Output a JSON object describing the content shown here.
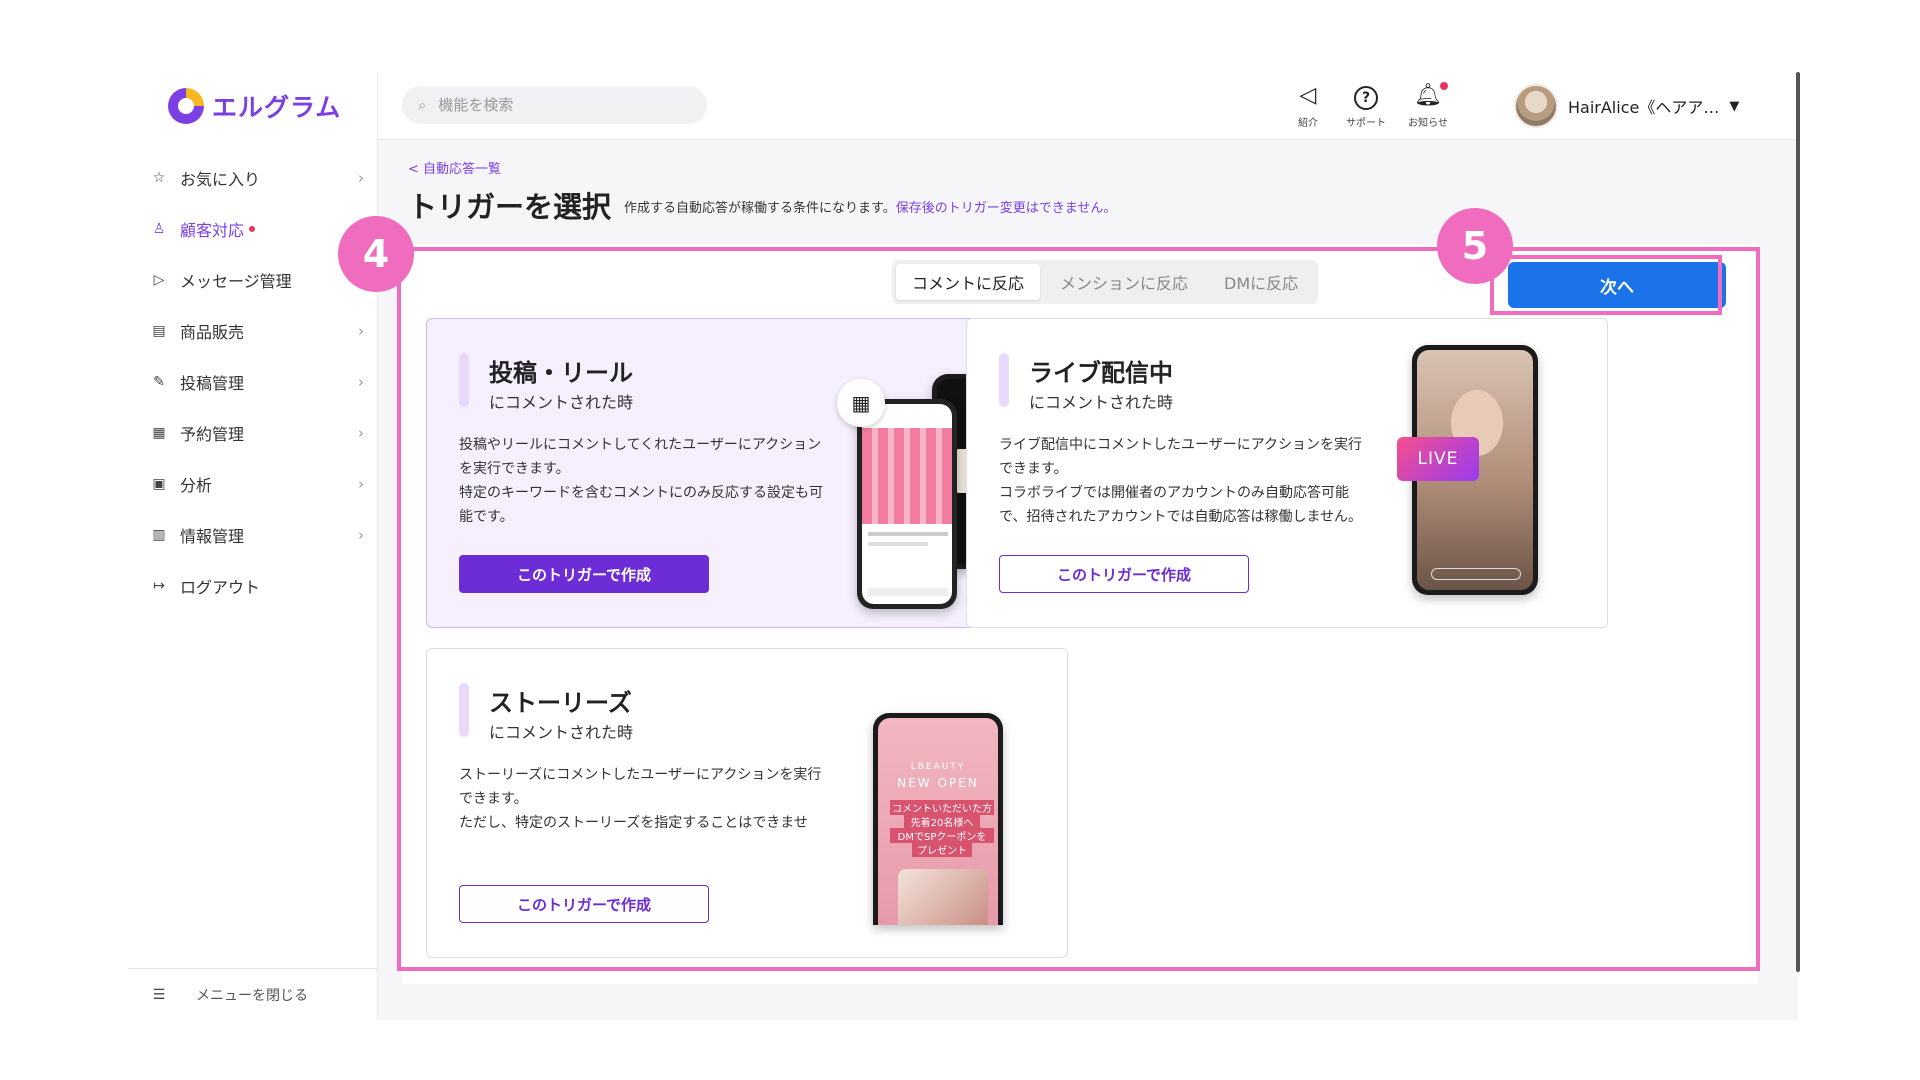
{
  "logo": {
    "text": "エルグラム"
  },
  "sidebar": {
    "items": [
      {
        "icon": "star-icon",
        "glyph": "☆",
        "label": "お気に入り",
        "chevron": true
      },
      {
        "icon": "person-icon",
        "glyph": "♙",
        "label": "顧客対応",
        "chevron": false,
        "active": true,
        "dot": true
      },
      {
        "icon": "send-icon",
        "glyph": "▷",
        "label": "メッセージ管理",
        "chevron": false
      },
      {
        "icon": "store-icon",
        "glyph": "▤",
        "label": "商品販売",
        "chevron": true
      },
      {
        "icon": "edit-icon",
        "glyph": "✎",
        "label": "投稿管理",
        "chevron": true
      },
      {
        "icon": "calendar-icon",
        "glyph": "▦",
        "label": "予約管理",
        "chevron": true
      },
      {
        "icon": "analytics-icon",
        "glyph": "▣",
        "label": "分析",
        "chevron": true
      },
      {
        "icon": "chart-icon",
        "glyph": "▥",
        "label": "情報管理",
        "chevron": true
      },
      {
        "icon": "logout-icon",
        "glyph": "↦",
        "label": "ログアウト",
        "chevron": false
      }
    ],
    "collapse_label": "メニューを閉じる"
  },
  "header": {
    "search_placeholder": "機能を検索",
    "buttons": [
      {
        "icon": "megaphone-icon",
        "glyph": "◁",
        "label": "紹介"
      },
      {
        "icon": "help-icon",
        "glyph": "?",
        "label": "サポート"
      },
      {
        "icon": "bell-icon",
        "glyph": "🔔︎",
        "label": "お知らせ"
      }
    ],
    "user_name": "HairAlice《ヘアア…"
  },
  "page": {
    "breadcrumb": "< 自動応答一覧",
    "title": "トリガーを選択",
    "desc": "作成する自動応答が稼働する条件になります。",
    "desc_warning": "保存後のトリガー変更はできません。"
  },
  "tabs": [
    "コメントに反応",
    "メンションに反応",
    "DMに反応"
  ],
  "next_label": "次へ",
  "cards": [
    {
      "title": "投稿・リール",
      "sub": "にコメントされた時",
      "desc": "投稿やリールにコメントしてくれたユーザーにアクション\nを実行できます。\n特定のキーワードを含むコメントにのみ反応する設定も可\n能です。",
      "button": "このトリガーで作成"
    },
    {
      "title": "ライブ配信中",
      "sub": "にコメントされた時",
      "desc": "ライブ配信中にコメントしたユーザーにアクションを実行\nできます。\nコラボライブでは開催者のアカウントのみ自動応答可能\nで、招待されたアカウントでは自動応答は稼働しません。",
      "button": "このトリガーで作成",
      "live": "LIVE"
    },
    {
      "title": "ストーリーズ",
      "sub": "にコメントされた時",
      "desc": "ストーリーズにコメントしたユーザーにアクションを実行\nできます。\nただし、特定のストーリーズを指定することはできませ",
      "button": "このトリガーで作成",
      "story": {
        "brand": "LBEAUTY",
        "headline": "NEW OPEN",
        "line1": "コメントいただいた方",
        "line2": "先着20名様へ",
        "line3": "DMでSPクーポンを",
        "line4": "プレゼント"
      }
    }
  ],
  "annotations": {
    "step4": "4",
    "step5": "5"
  },
  "colors": {
    "accent": "#7b3fe4",
    "primary_button": "#1a73e8",
    "highlight": "#f06cbf"
  }
}
